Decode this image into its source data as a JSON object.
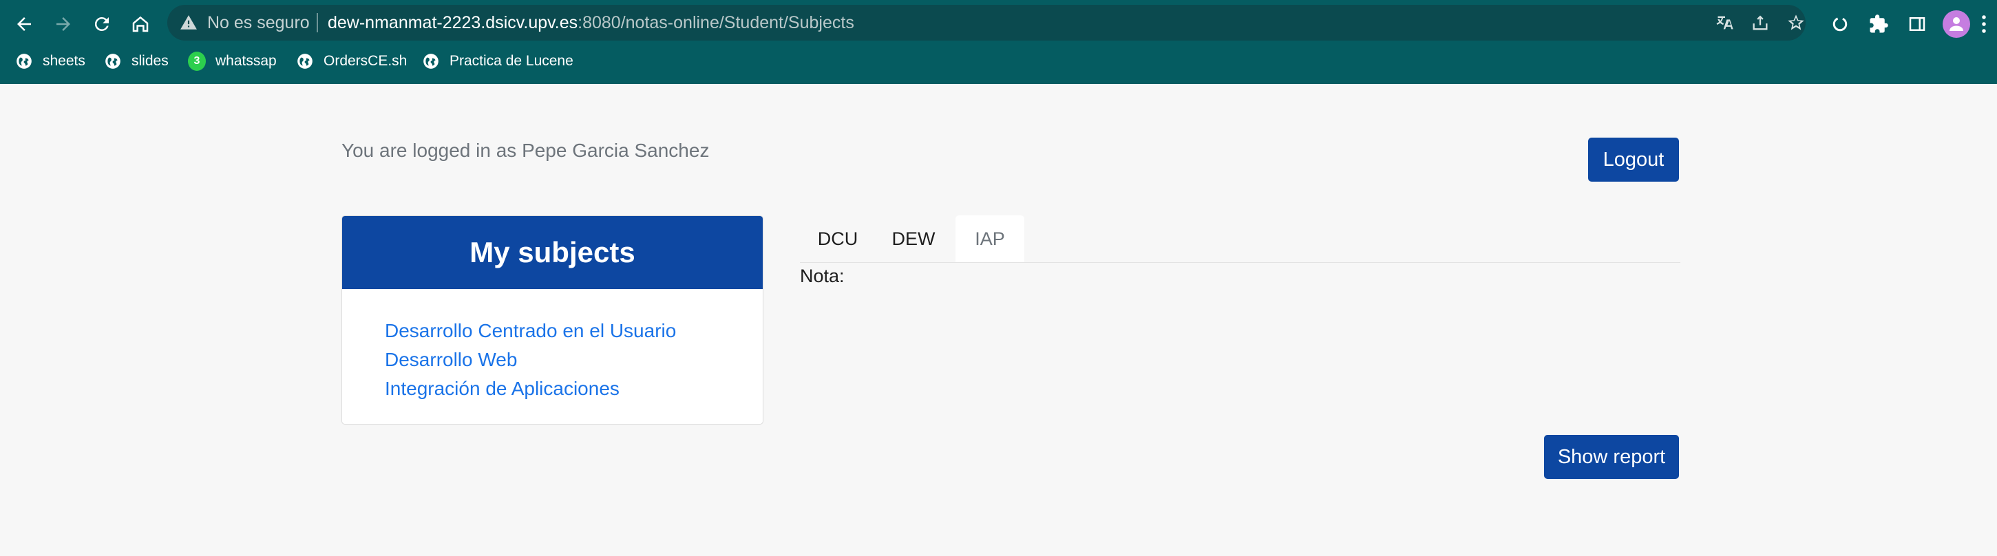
{
  "browser": {
    "security_label": "No es seguro",
    "url_host": "dew-nmanmat-2223.dsicv.upv.es",
    "url_path": ":8080/notas-online/Student/Subjects",
    "bookmarks": [
      {
        "label": "sheets",
        "icon": "globe-icon"
      },
      {
        "label": "slides",
        "icon": "globe-icon"
      },
      {
        "label": "whatssap",
        "icon": "whatsapp-icon",
        "badge": "3"
      },
      {
        "label": "OrdersCE.sh",
        "icon": "globe-icon"
      },
      {
        "label": "Practica de Lucene",
        "icon": "globe-icon"
      }
    ],
    "colors": {
      "toolbar": "#055c61",
      "omnibox": "#0b4a4f",
      "avatar": "#c57de0"
    }
  },
  "page": {
    "logged_in_text": "You are logged in as Pepe Garcia Sanchez",
    "logout_label": "Logout",
    "subjects_title": "My subjects",
    "subjects": [
      "Desarrollo Centrado en el Usuario",
      "Desarrollo Web",
      "Integración de Aplicaciones"
    ],
    "tabs": [
      {
        "label": "DCU",
        "active": false
      },
      {
        "label": "DEW",
        "active": false
      },
      {
        "label": "IAP",
        "active": true
      }
    ],
    "grade_label": "Nota:",
    "report_label": "Show report",
    "colors": {
      "primary": "#0d47a1",
      "link": "#1a73e8"
    }
  }
}
